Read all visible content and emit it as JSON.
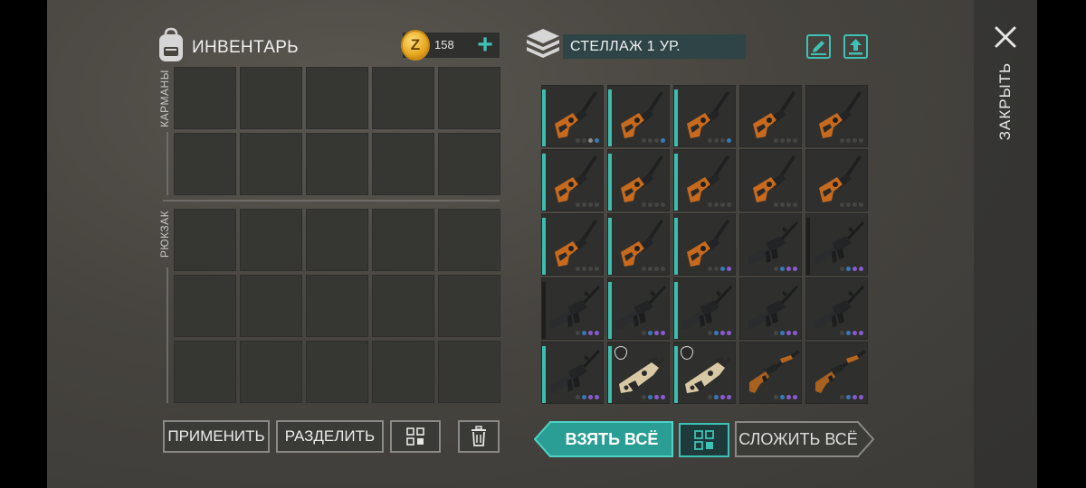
{
  "inventory": {
    "title": "ИНВЕНТАРЬ",
    "coins": "158",
    "coin_symbol": "Z",
    "pockets_label": "КАРМАНЫ",
    "backpack_label": "РЮКЗАК",
    "apply_label": "ПРИМЕНИТЬ",
    "split_label": "РАЗДЕЛИТЬ"
  },
  "stash": {
    "title": "СТЕЛЛАЖ 1 УР.",
    "take_all_label": "ВЗЯТЬ ВСЁ",
    "stack_all_label": "СЛОЖИТЬ ВСЁ",
    "slots": [
      {
        "weapon": "pistol",
        "dots": [
          "#454643",
          "#454643",
          "#8c8c8c",
          "#3a78b8"
        ],
        "rarity": "#3dbcb0"
      },
      {
        "weapon": "pistol",
        "dots": [
          "#454643",
          "#454643",
          "#454643",
          "#3a78b8"
        ],
        "rarity": "#3dbcb0"
      },
      {
        "weapon": "pistol",
        "dots": [
          "#454643",
          "#454643",
          "#454643",
          "#3a78b8"
        ],
        "rarity": "#3dbcb0"
      },
      {
        "weapon": "pistol",
        "dots": [
          "#454643",
          "#454643",
          "#454643",
          "#454643"
        ],
        "rarity": "none"
      },
      {
        "weapon": "pistol",
        "dots": [
          "#454643",
          "#454643",
          "#454643",
          "#454643"
        ],
        "rarity": "none"
      },
      {
        "weapon": "pistol",
        "dots": [
          "#454643",
          "#454643",
          "#454643",
          "#454643"
        ],
        "rarity": "#3dbcb0"
      },
      {
        "weapon": "pistol",
        "dots": [
          "#454643",
          "#454643",
          "#454643",
          "#454643"
        ],
        "rarity": "#3dbcb0"
      },
      {
        "weapon": "pistol",
        "dots": [
          "#454643",
          "#454643",
          "#454643",
          "#454643"
        ],
        "rarity": "#3dbcb0"
      },
      {
        "weapon": "pistol",
        "dots": [
          "#454643",
          "#454643",
          "#454643",
          "#454643"
        ],
        "rarity": "none"
      },
      {
        "weapon": "pistol",
        "dots": [
          "#454643",
          "#454643",
          "#454643",
          "#454643"
        ],
        "rarity": "none"
      },
      {
        "weapon": "pistol",
        "dots": [
          "#454643",
          "#454643",
          "#454643",
          "#454643"
        ],
        "rarity": "#3dbcb0"
      },
      {
        "weapon": "pistol",
        "dots": [
          "#454643",
          "#454643",
          "#454643",
          "#454643"
        ],
        "rarity": "#3dbcb0"
      },
      {
        "weapon": "pistol",
        "dots": [
          "#454643",
          "#454643",
          "#3a78b8",
          "#8a5ad0"
        ],
        "rarity": "#3dbcb0"
      },
      {
        "weapon": "rifle",
        "dots": [
          "#454643",
          "#3a78b8",
          "#8a5ad0",
          "#8a5ad0"
        ],
        "rarity": "none"
      },
      {
        "weapon": "rifle",
        "dots": [
          "#454643",
          "#3a78b8",
          "#8a5ad0",
          "#8a5ad0"
        ],
        "rarity": "#1e1e1d"
      },
      {
        "weapon": "rifle",
        "dots": [
          "#454643",
          "#3a78b8",
          "#8a5ad0",
          "#8a5ad0"
        ],
        "rarity": "#1e1e1d"
      },
      {
        "weapon": "rifle",
        "dots": [
          "#454643",
          "#3a78b8",
          "#8a5ad0",
          "#8a5ad0"
        ],
        "rarity": "#3dbcb0"
      },
      {
        "weapon": "rifle",
        "dots": [
          "#454643",
          "#3a78b8",
          "#8a5ad0",
          "#8a5ad0"
        ],
        "rarity": "#3dbcb0"
      },
      {
        "weapon": "rifle",
        "dots": [
          "#454643",
          "#3a78b8",
          "#8a5ad0",
          "#8a5ad0"
        ],
        "rarity": "none"
      },
      {
        "weapon": "rifle",
        "dots": [
          "#454643",
          "#3a78b8",
          "#8a5ad0",
          "#8a5ad0"
        ],
        "rarity": "none"
      },
      {
        "weapon": "rifle",
        "dots": [
          "#454643",
          "#3a78b8",
          "#8a5ad0",
          "#8a5ad0"
        ],
        "rarity": "#3dbcb0"
      },
      {
        "weapon": "bullpup",
        "dots": [
          "#454643",
          "#3a78b8",
          "#8a5ad0",
          "#8a5ad0"
        ],
        "rarity": "#3dbcb0",
        "shield": true
      },
      {
        "weapon": "bullpup",
        "dots": [
          "#454643",
          "#3a78b8",
          "#8a5ad0",
          "#8a5ad0"
        ],
        "rarity": "#3dbcb0",
        "shield": true
      },
      {
        "weapon": "shotgun",
        "dots": [
          "#454643",
          "#3a78b8",
          "#8a5ad0",
          "#8a5ad0"
        ],
        "rarity": "none"
      },
      {
        "weapon": "shotgun",
        "dots": [
          "#454643",
          "#3a78b8",
          "#8a5ad0",
          "#8a5ad0"
        ],
        "rarity": "none"
      }
    ]
  },
  "close_label": "ЗАКРЫТЬ",
  "icons": {
    "close": "close-icon",
    "backpack": "backpack-icon",
    "stash": "stash-box-icon",
    "rename": "edit-icon",
    "upload": "upload-icon",
    "sort": "sort-grid-icon",
    "trash": "trash-icon"
  },
  "colors": {
    "accent": "#3dc2b5",
    "take_all_bg": "#2a9e94",
    "stash_title_bg": "#2e4446"
  }
}
